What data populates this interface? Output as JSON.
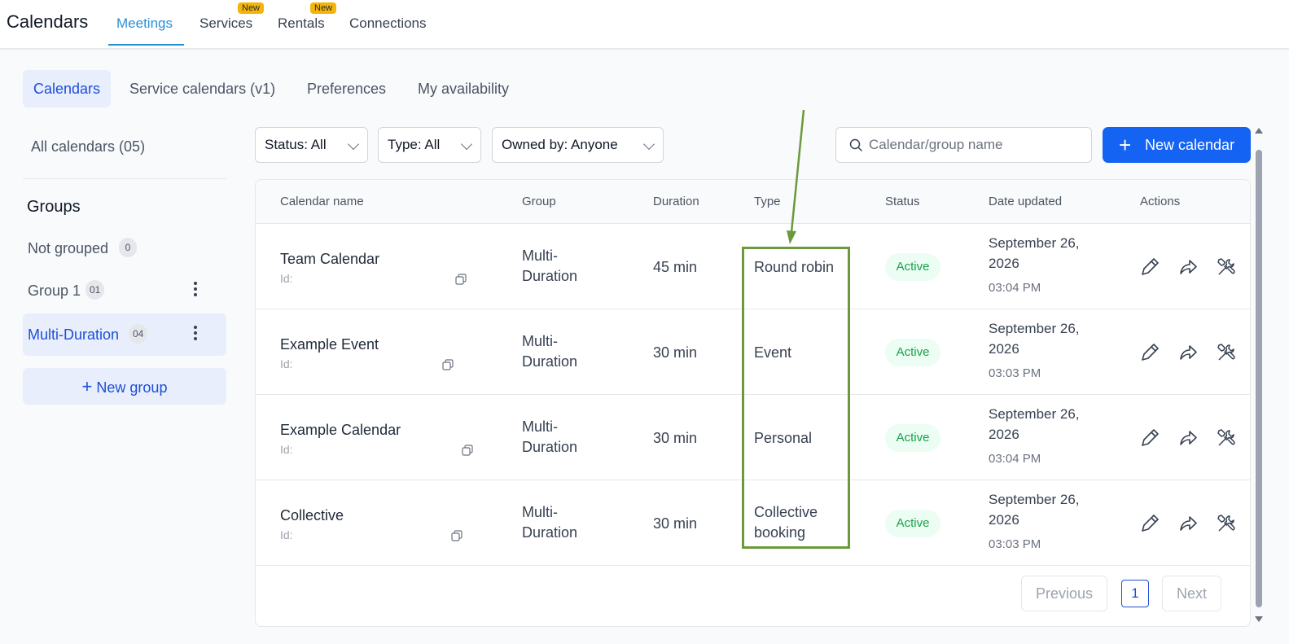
{
  "app_title": "Calendars",
  "top_tabs": [
    {
      "label": "Meetings",
      "badge": ""
    },
    {
      "label": "Services",
      "badge": "New"
    },
    {
      "label": "Rentals",
      "badge": "New"
    },
    {
      "label": "Connections",
      "badge": ""
    }
  ],
  "sub_tabs": [
    "Calendars",
    "Service calendars (v1)",
    "Preferences",
    "My availability"
  ],
  "sidebar": {
    "all_calendars": "All calendars (05)",
    "groups_title": "Groups",
    "groups": [
      {
        "label": "Not grouped",
        "count": "0"
      },
      {
        "label": "Group 1",
        "count": "01"
      },
      {
        "label": "Multi-Duration",
        "count": "04"
      }
    ],
    "new_group": "New group"
  },
  "filters": {
    "status": "Status: All",
    "type": "Type: All",
    "owned_by": "Owned by: Anyone"
  },
  "search": {
    "placeholder": "Calendar/group name"
  },
  "new_calendar": "New calendar",
  "table": {
    "headers": [
      "Calendar name",
      "Group",
      "Duration",
      "Type",
      "Status",
      "Date updated",
      "Actions"
    ],
    "rows": [
      {
        "name": "Team Calendar",
        "id": "Id:",
        "group_1": "Multi-",
        "group_2": "Duration",
        "duration": "45 min",
        "type_1": "Round robin",
        "type_2": "",
        "status": "Active",
        "date_1": "September 26,",
        "date_2": "2026",
        "time": "03:04 PM"
      },
      {
        "name": "Example Event",
        "id": "Id:",
        "group_1": "Multi-",
        "group_2": "Duration",
        "duration": "30 min",
        "type_1": "Event",
        "type_2": "",
        "status": "Active",
        "date_1": "September 26,",
        "date_2": "2026",
        "time": "03:03 PM"
      },
      {
        "name": "Example Calendar",
        "id": "Id:",
        "group_1": "Multi-",
        "group_2": "Duration",
        "duration": "30 min",
        "type_1": "Personal",
        "type_2": "",
        "status": "Active",
        "date_1": "September 26,",
        "date_2": "2026",
        "time": "03:04 PM"
      },
      {
        "name": "Collective",
        "id": "Id:",
        "group_1": "Multi-",
        "group_2": "Duration",
        "duration": "30 min",
        "type_1": "Collective",
        "type_2": "booking",
        "status": "Active",
        "date_1": "September 26,",
        "date_2": "2026",
        "time": "03:03 PM"
      }
    ]
  },
  "pagination": {
    "previous": "Previous",
    "page": "1",
    "next": "Next"
  },
  "colors": {
    "primary": "#1463f3",
    "tab_active": "#2b8fd6",
    "active_badge": "#16a34a",
    "annotation": "#6a9a3a",
    "new_badge": "#f5b40a"
  }
}
